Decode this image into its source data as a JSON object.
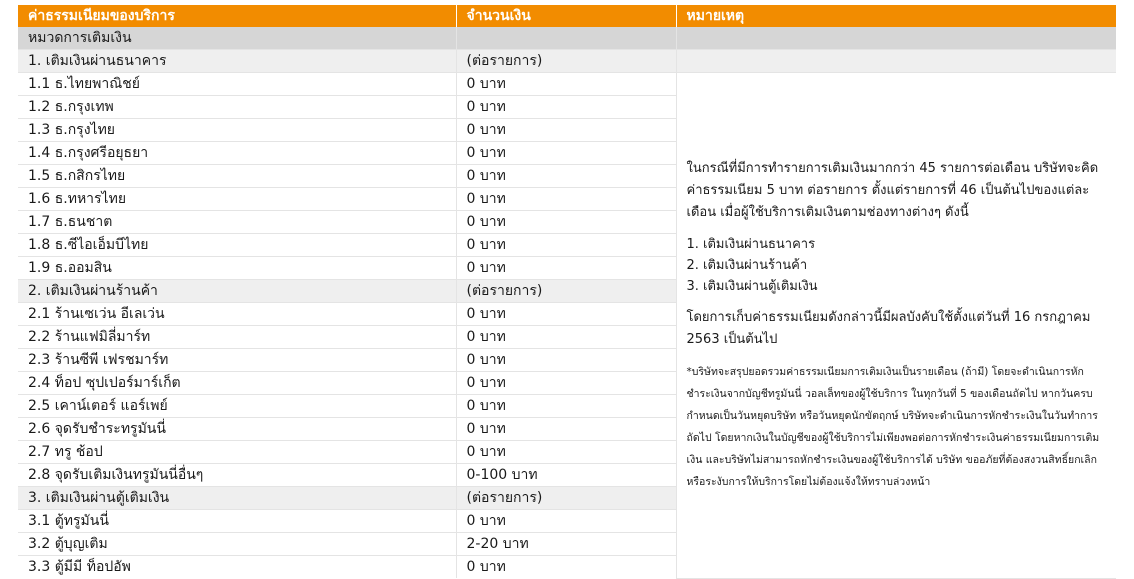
{
  "header": {
    "col_fee": "ค่าธรรมเนียมของบริการ",
    "col_amount": "จำนวนเงิน",
    "col_note": "หมายเหตุ"
  },
  "category": "หมวดการเติมเงิน",
  "groups": [
    {
      "title": "1. เติมเงินผ่านธนาคาร",
      "unit": "(ต่อรายการ)",
      "items": [
        {
          "label": "1.1 ธ.ไทยพาณิชย์",
          "amount": "0 บาท"
        },
        {
          "label": "1.2 ธ.กรุงเทพ",
          "amount": "0 บาท"
        },
        {
          "label": "1.3 ธ.กรุงไทย",
          "amount": "0 บาท"
        },
        {
          "label": "1.4 ธ.กรุงศรีอยุธยา",
          "amount": "0 บาท"
        },
        {
          "label": "1.5 ธ.กสิกรไทย",
          "amount": "0 บาท"
        },
        {
          "label": "1.6 ธ.ทหารไทย",
          "amount": "0 บาท"
        },
        {
          "label": "1.7 ธ.ธนชาต",
          "amount": "0 บาท"
        },
        {
          "label": "1.8 ธ.ซีไอเอ็มบีไทย",
          "amount": "0 บาท"
        },
        {
          "label": "1.9 ธ.ออมสิน",
          "amount": "0 บาท"
        }
      ]
    },
    {
      "title": "2. เติมเงินผ่านร้านค้า",
      "unit": "(ต่อรายการ)",
      "items": [
        {
          "label": "2.1 ร้านเซเว่น อีเลเว่น",
          "amount": "0 บาท"
        },
        {
          "label": "2.2 ร้านแฟมิลี่มาร์ท",
          "amount": "0 บาท"
        },
        {
          "label": "2.3 ร้านซีพี เฟรชมาร์ท",
          "amount": "0 บาท"
        },
        {
          "label": "2.4 ท็อป ซุปเปอร์มาร์เก็ต",
          "amount": "0 บาท"
        },
        {
          "label": "2.5 เคาน์เตอร์ แอร์เพย์",
          "amount": "0 บาท"
        },
        {
          "label": "2.6 จุดรับชำระทรูมันนี่",
          "amount": "0 บาท"
        },
        {
          "label": "2.7 ทรู ช้อป",
          "amount": "0 บาท"
        },
        {
          "label": "2.8 จุดรับเติมเงินทรูมันนี่อื่นๆ",
          "amount": "0-100 บาท"
        }
      ]
    },
    {
      "title": "3. เติมเงินผ่านตู้เติมเงิน",
      "unit": "(ต่อรายการ)",
      "items": [
        {
          "label": "3.1 ตู้ทรูมันนี่",
          "amount": "0 บาท"
        },
        {
          "label": "3.2 ตู้บุญเติม",
          "amount": "2-20 บาท"
        },
        {
          "label": "3.3 ตู้มีมี ท็อปอัพ",
          "amount": "0 บาท"
        }
      ]
    }
  ],
  "note": {
    "main": "ในกรณีที่มีการทำรายการเติมเงินมากกว่า 45 รายการต่อเดือน บริษัทจะคิดค่าธรรมเนียม 5 บาท ต่อรายการ ตั้งแต่รายการที่ 46 เป็นต้นไปของแต่ละเดือน เมื่อผู้ใช้บริการเติมเงินตามช่องทางต่างๆ ดังนี้",
    "list": [
      "1. เติมเงินผ่านธนาคาร",
      "2. เติมเงินผ่านร้านค้า",
      "3. เติมเงินผ่านตู้เติมเงิน"
    ],
    "effective": "โดยการเก็บค่าธรรมเนียมดังกล่าวนี้มีผลบังคับใช้ตั้งแต่วันที่ 16 กรกฎาคม 2563 เป็นต้นไป",
    "fine_print": "*บริษัทจะสรุปยอดรวมค่าธรรมเนียมการเติมเงินเป็นรายเดือน (ถ้ามี) โดยจะดำเนินการหักชำระเงินจากบัญชีทรูมันนี่ วอลเล็ทของผู้ใช้บริการ ในทุกวันที่ 5 ของเดือนถัดไป หากวันครบกำหนดเป็นวันหยุดบริษัท หรือวันหยุดนักขัตฤกษ์ บริษัทจะดำเนินการหักชำระเงินในวันทำการถัดไป โดยหากเงินในบัญชีของผู้ใช้บริการไม่เพียงพอต่อการหักชำระเงินค่าธรรมเนียมการเติมเงิน และบริษัทไม่สามารถหักชำระเงินของผู้ใช้บริการได้ บริษัท ขออภัยที่ต้องสงวนสิทธิ์ยกเลิกหรือระงับการให้บริการโดยไม่ต้องแจ้งให้ทราบล่วงหน้า"
  }
}
